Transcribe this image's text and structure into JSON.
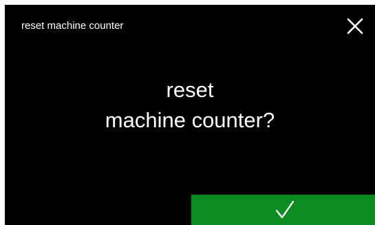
{
  "header": {
    "title": "reset machine counter",
    "close_icon": "close-icon"
  },
  "dialog": {
    "line1": "reset",
    "line2": "machine counter?"
  },
  "confirm": {
    "icon": "checkmark-icon"
  },
  "colors": {
    "background": "#000000",
    "text": "#ffffff",
    "confirm_button": "#0b8c1e"
  }
}
